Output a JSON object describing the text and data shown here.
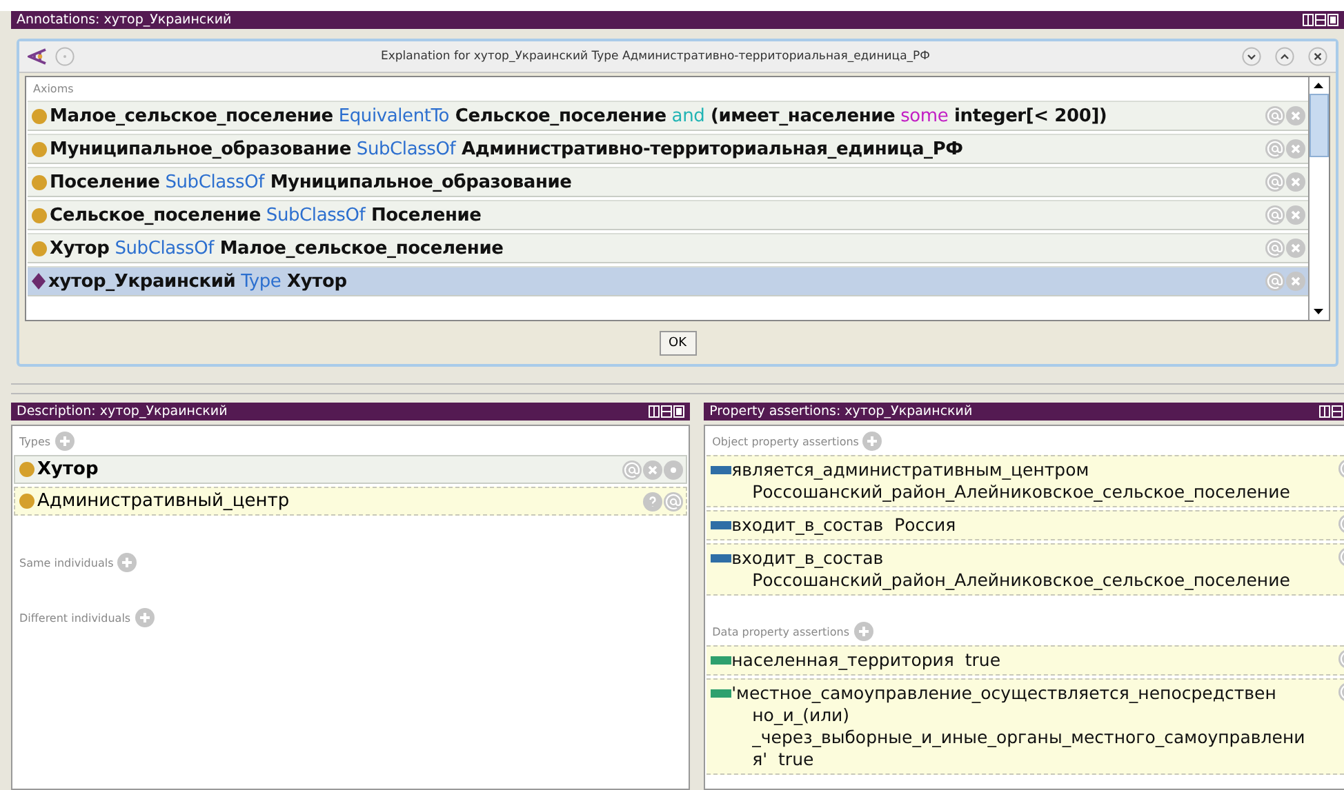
{
  "annotations_panel": {
    "title": "Annotations: хутор_Украинский"
  },
  "dialog": {
    "title": "Explanation for хутор_Украинский Type Административно-территориальная_единица_РФ",
    "section": "Axioms",
    "axioms": [
      {
        "kind": "class",
        "selected": false,
        "parts": [
          {
            "kind": "name",
            "text": "Малое_сельское_поселение"
          },
          {
            "kind": "keyword",
            "text": "EquivalentTo"
          },
          {
            "kind": "name",
            "text": "Сельское_поселение"
          },
          {
            "kind": "connective",
            "text": "and"
          },
          {
            "kind": "name",
            "text": "(имеет_население"
          },
          {
            "kind": "quantifier",
            "text": "some"
          },
          {
            "kind": "name",
            "text": "integer[< 200])"
          }
        ]
      },
      {
        "kind": "class",
        "selected": false,
        "parts": [
          {
            "kind": "name",
            "text": "Муниципальное_образование"
          },
          {
            "kind": "keyword",
            "text": "SubClassOf"
          },
          {
            "kind": "name",
            "text": "Административно-территориальная_единица_РФ"
          }
        ]
      },
      {
        "kind": "class",
        "selected": false,
        "parts": [
          {
            "kind": "name",
            "text": "Поселение"
          },
          {
            "kind": "keyword",
            "text": "SubClassOf"
          },
          {
            "kind": "name",
            "text": "Муниципальное_образование"
          }
        ]
      },
      {
        "kind": "class",
        "selected": false,
        "parts": [
          {
            "kind": "name",
            "text": "Сельское_поселение"
          },
          {
            "kind": "keyword",
            "text": "SubClassOf"
          },
          {
            "kind": "name",
            "text": "Поселение"
          }
        ]
      },
      {
        "kind": "class",
        "selected": false,
        "parts": [
          {
            "kind": "name",
            "text": "Хутор"
          },
          {
            "kind": "keyword",
            "text": "SubClassOf"
          },
          {
            "kind": "name",
            "text": "Малое_сельское_поселение"
          }
        ]
      },
      {
        "kind": "individual",
        "selected": true,
        "parts": [
          {
            "kind": "name",
            "text": "хутор_Украинский"
          },
          {
            "kind": "keyword",
            "text": "Type"
          },
          {
            "kind": "name",
            "text": "Хутор"
          }
        ]
      }
    ],
    "ok_button": "OK"
  },
  "description": {
    "title": "Description: хутор_Украинский",
    "types_label": "Types",
    "types": [
      {
        "text": "Хутор",
        "inferred": false
      },
      {
        "text": "Административный_центр",
        "inferred": true
      }
    ],
    "same_label": "Same individuals",
    "different_label": "Different individuals"
  },
  "property_assertions": {
    "title": "Property assertions: хутор_Украинский",
    "object_label": "Object property assertions",
    "object_assertions": [
      {
        "lines": [
          "является_административным_центром",
          "Россошанский_район_Алейниковское_сельское_поселение"
        ]
      },
      {
        "lines": [
          "входит_в_состав  Россия"
        ]
      },
      {
        "lines": [
          "входит_в_состав",
          "Россошанский_район_Алейниковское_сельское_поселение"
        ]
      }
    ],
    "data_label": "Data property assertions",
    "data_assertions": [
      {
        "lines": [
          "населенная_территория  true"
        ]
      },
      {
        "lines": [
          "'местное_самоуправление_осуществляется_непосредствен",
          "но_и_(или)",
          "_через_выборные_и_иные_органы_местного_самоуправлени",
          "я'  true"
        ]
      }
    ]
  }
}
